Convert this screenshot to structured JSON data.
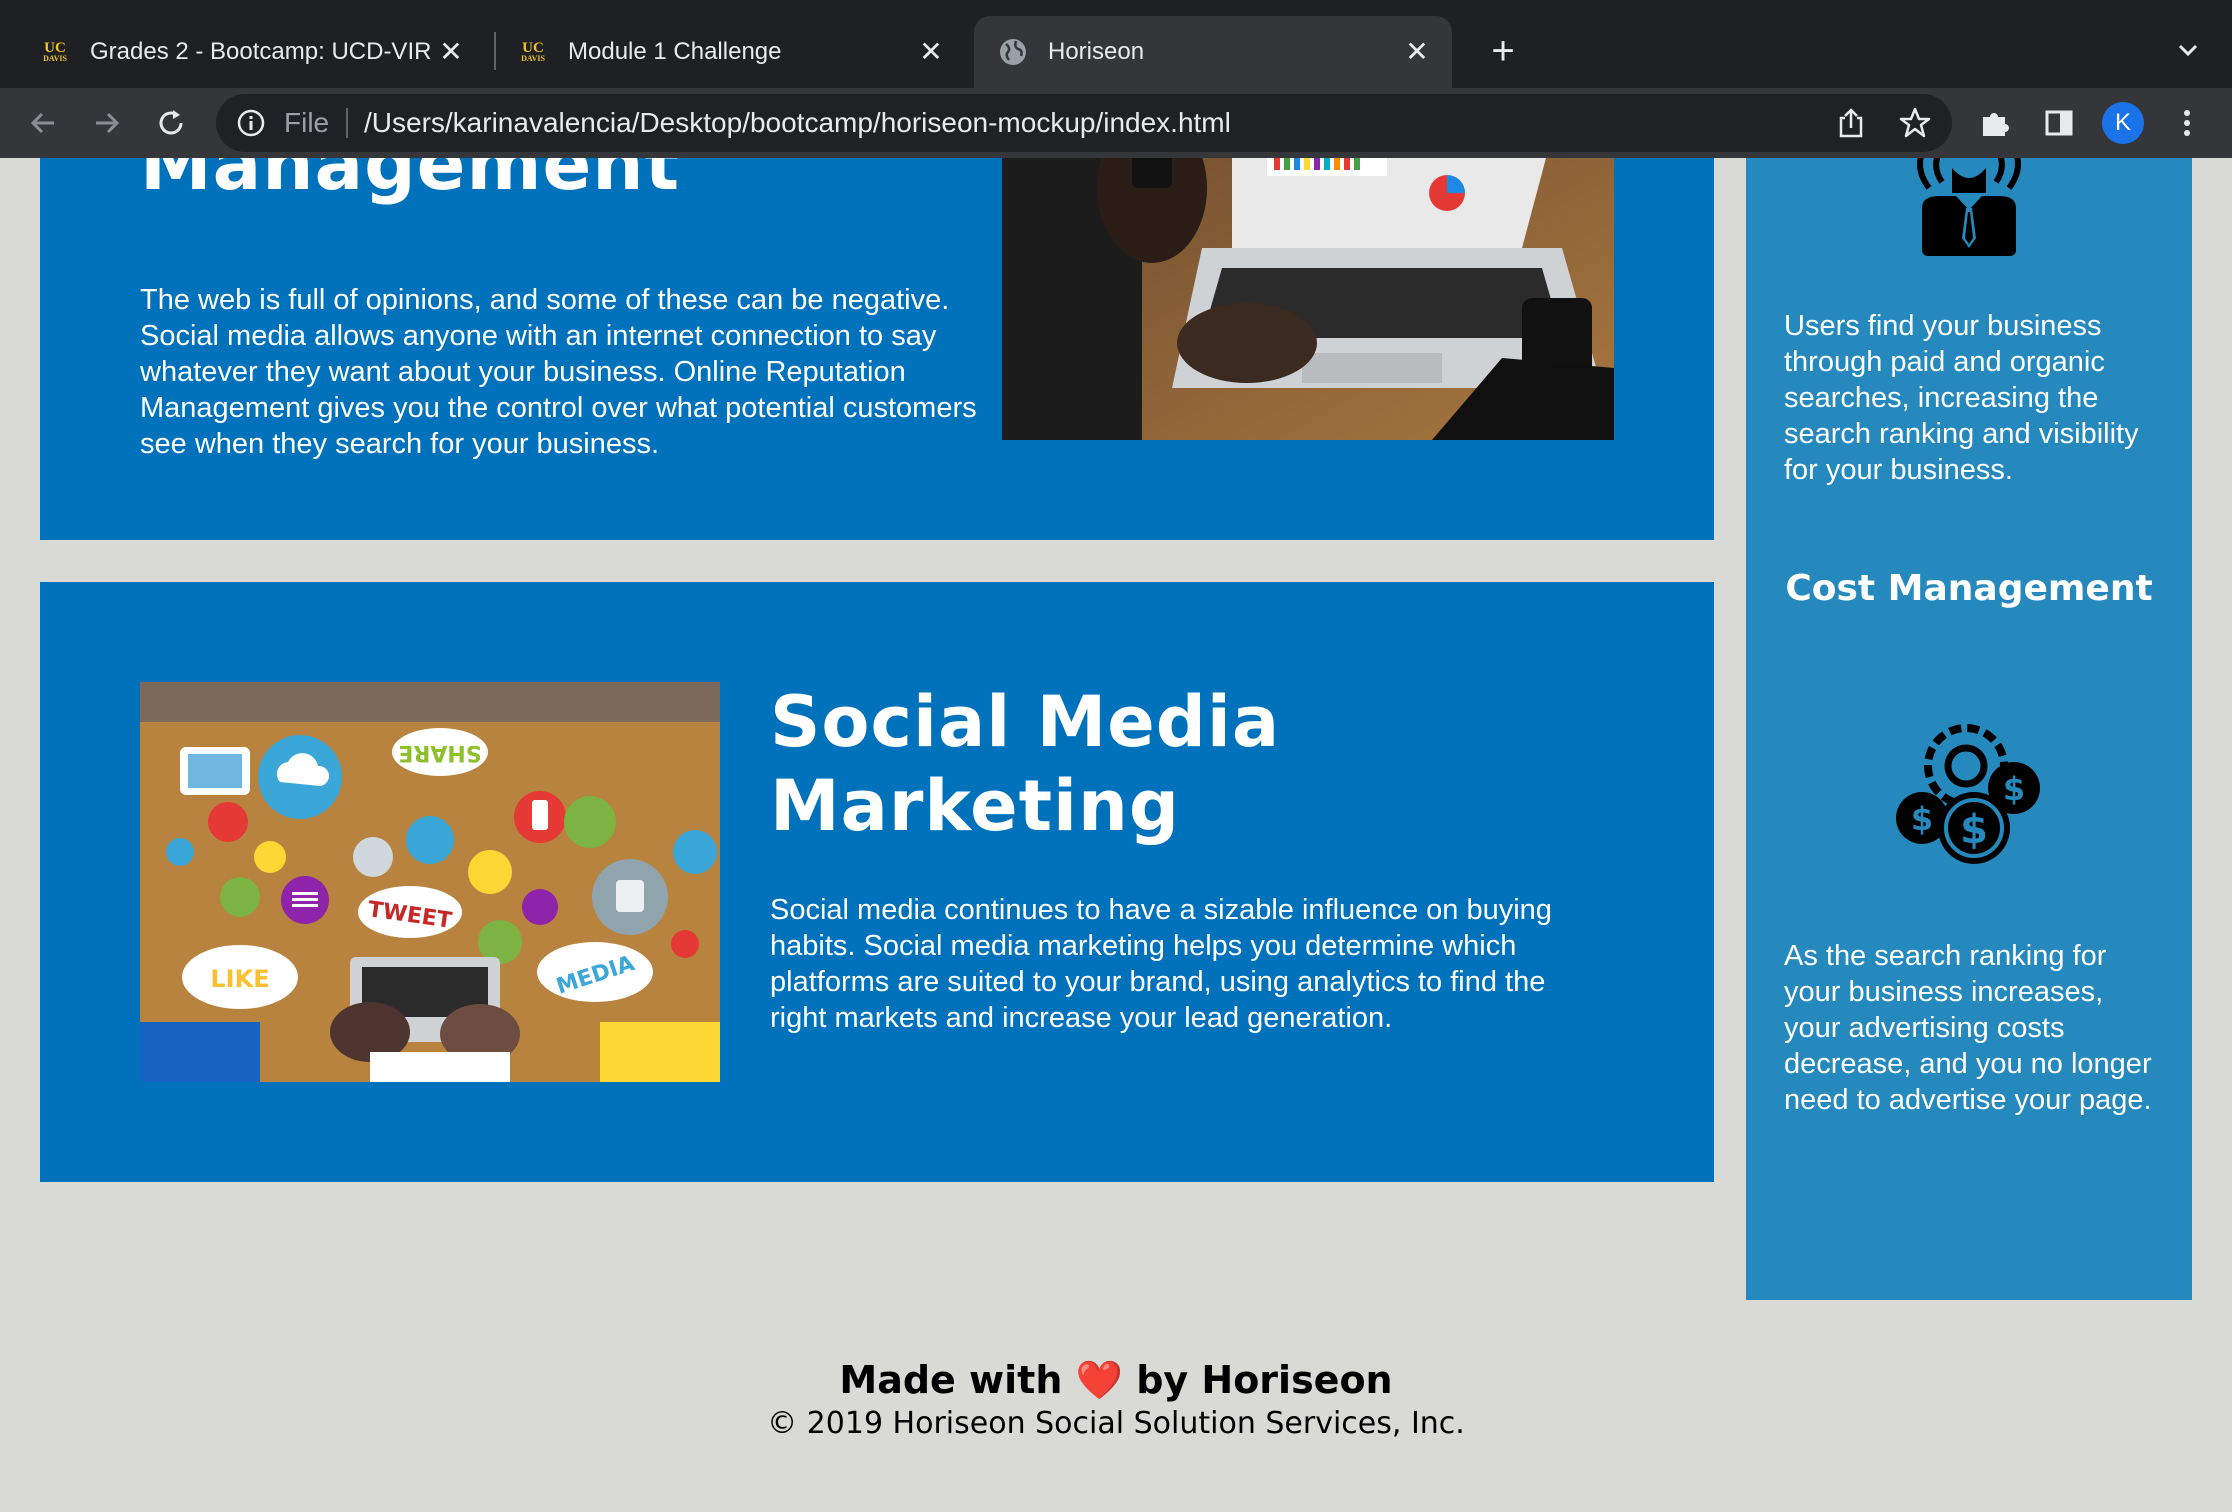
{
  "browser": {
    "tabs": [
      {
        "title": "Grades 2 - Bootcamp: UCD-VIR",
        "favicon": "uc-davis-logo"
      },
      {
        "title": "Module 1 Challenge",
        "favicon": "uc-davis-logo"
      },
      {
        "title": "Horiseon",
        "favicon": "globe-icon",
        "active": true
      }
    ],
    "favicon_text": {
      "top": "UC",
      "bottom": "DAVIS"
    },
    "new_tab_label": "+",
    "omnibox": {
      "scheme_label": "File",
      "url": "/Users/karinavalencia/Desktop/bootcamp/horiseon-mockup/index.html"
    },
    "profile_initial": "K",
    "colors": {
      "tabbar": "#1f2023",
      "toolbar": "#35363a",
      "avatar": "#1a73e8"
    }
  },
  "page": {
    "online_reputation": {
      "heading": "Management",
      "text": "The web is full of opinions, and some of these can be negative. Social media allows anyone with an internet connection to say whatever they want about your business. Online Reputation Management gives you the control over what potential customers see when they search for your business."
    },
    "social_media": {
      "heading_line1": "Social Media",
      "heading_line2": "Marketing",
      "text": "Social media continues to have a sizable influence on buying habits. Social media marketing helps you determine which platforms are suited to your brand, using analytics to find the right markets and increase your lead generation.",
      "image_labels": {
        "share": "SHARE",
        "tweet": "TWEET",
        "like": "LIKE",
        "media": "MEDIA"
      }
    },
    "benefits": {
      "lead_text": "Users find your business through paid and organic searches, increasing the search ranking and visibility for your business.",
      "cost_heading": "Cost Management",
      "cost_text": "As the search ranking for your business increases, your advertising costs decrease, and you no longer need to advertise your page."
    },
    "footer": {
      "made_prefix": "Made with",
      "heart": "❤️",
      "made_suffix": "by Horiseon",
      "copyright": "© 2019 Horiseon Social Solution Services, Inc."
    },
    "colors": {
      "section": "#0072bb",
      "aside": "#2589bd",
      "background": "#d9dad5"
    }
  }
}
